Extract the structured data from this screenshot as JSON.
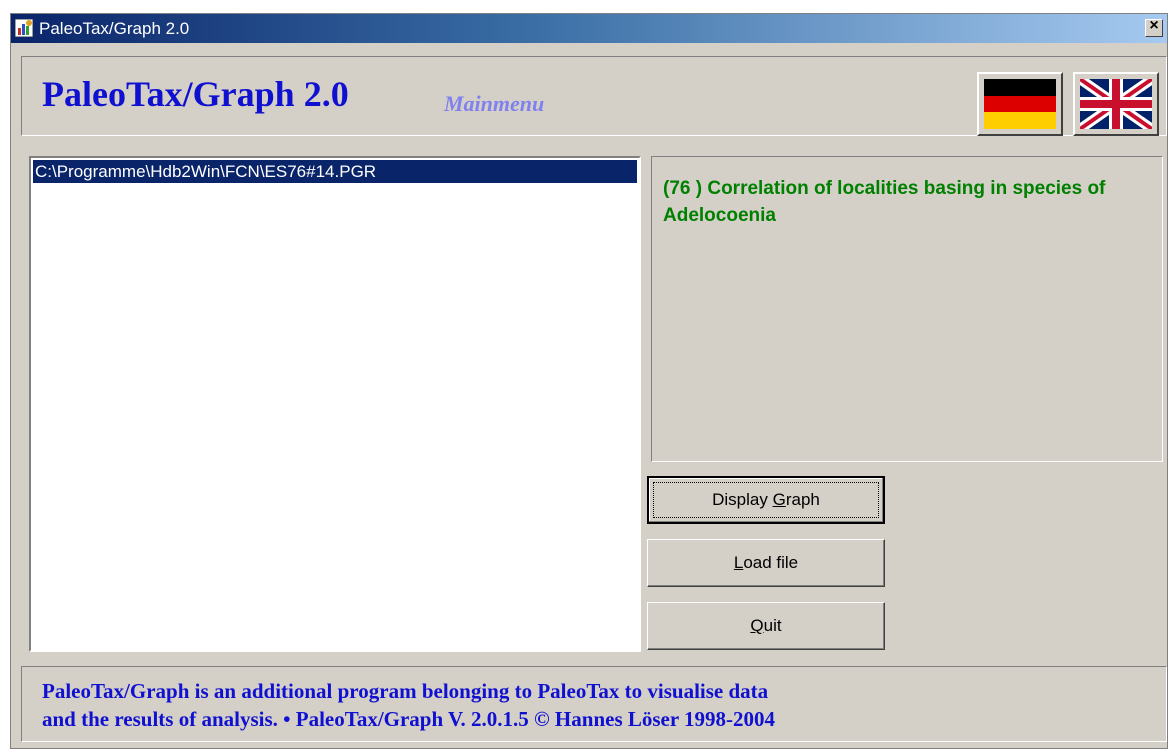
{
  "window": {
    "title": "PaleoTax/Graph 2.0",
    "close_symbol": "×"
  },
  "header": {
    "app_title": "PaleoTax/Graph  2.0",
    "subtitle": "Mainmenu"
  },
  "language_flags": [
    {
      "name": "german-flag-icon",
      "language": "German"
    },
    {
      "name": "uk-flag-icon",
      "language": "English"
    }
  ],
  "file_list": {
    "items": [
      "C:\\Programme\\Hdb2Win\\FCN\\ES76#14.PGR"
    ],
    "selected_index": 0
  },
  "description": {
    "text": "(76 ) Correlation of localities basing in species of Adelocoenia"
  },
  "buttons": {
    "display_graph": {
      "before": "Display ",
      "accel": "G",
      "after": "raph"
    },
    "load_file": {
      "before": "",
      "accel": "L",
      "after": "oad file"
    },
    "quit": {
      "before": "",
      "accel": "Q",
      "after": "uit"
    }
  },
  "footer": {
    "line1": "PaleoTax/Graph is an additional program belonging to PaleoTax to visualise data",
    "line2": "and the results of analysis. • PaleoTax/Graph V. 2.0.1.5 © Hannes Löser 1998-2004"
  },
  "colors": {
    "title_blue": "#1010d0",
    "subtitle_blue": "#8080ee",
    "description_green": "#008000",
    "selection_navy": "#0a246a",
    "window_grey": "#d4d0c8"
  }
}
